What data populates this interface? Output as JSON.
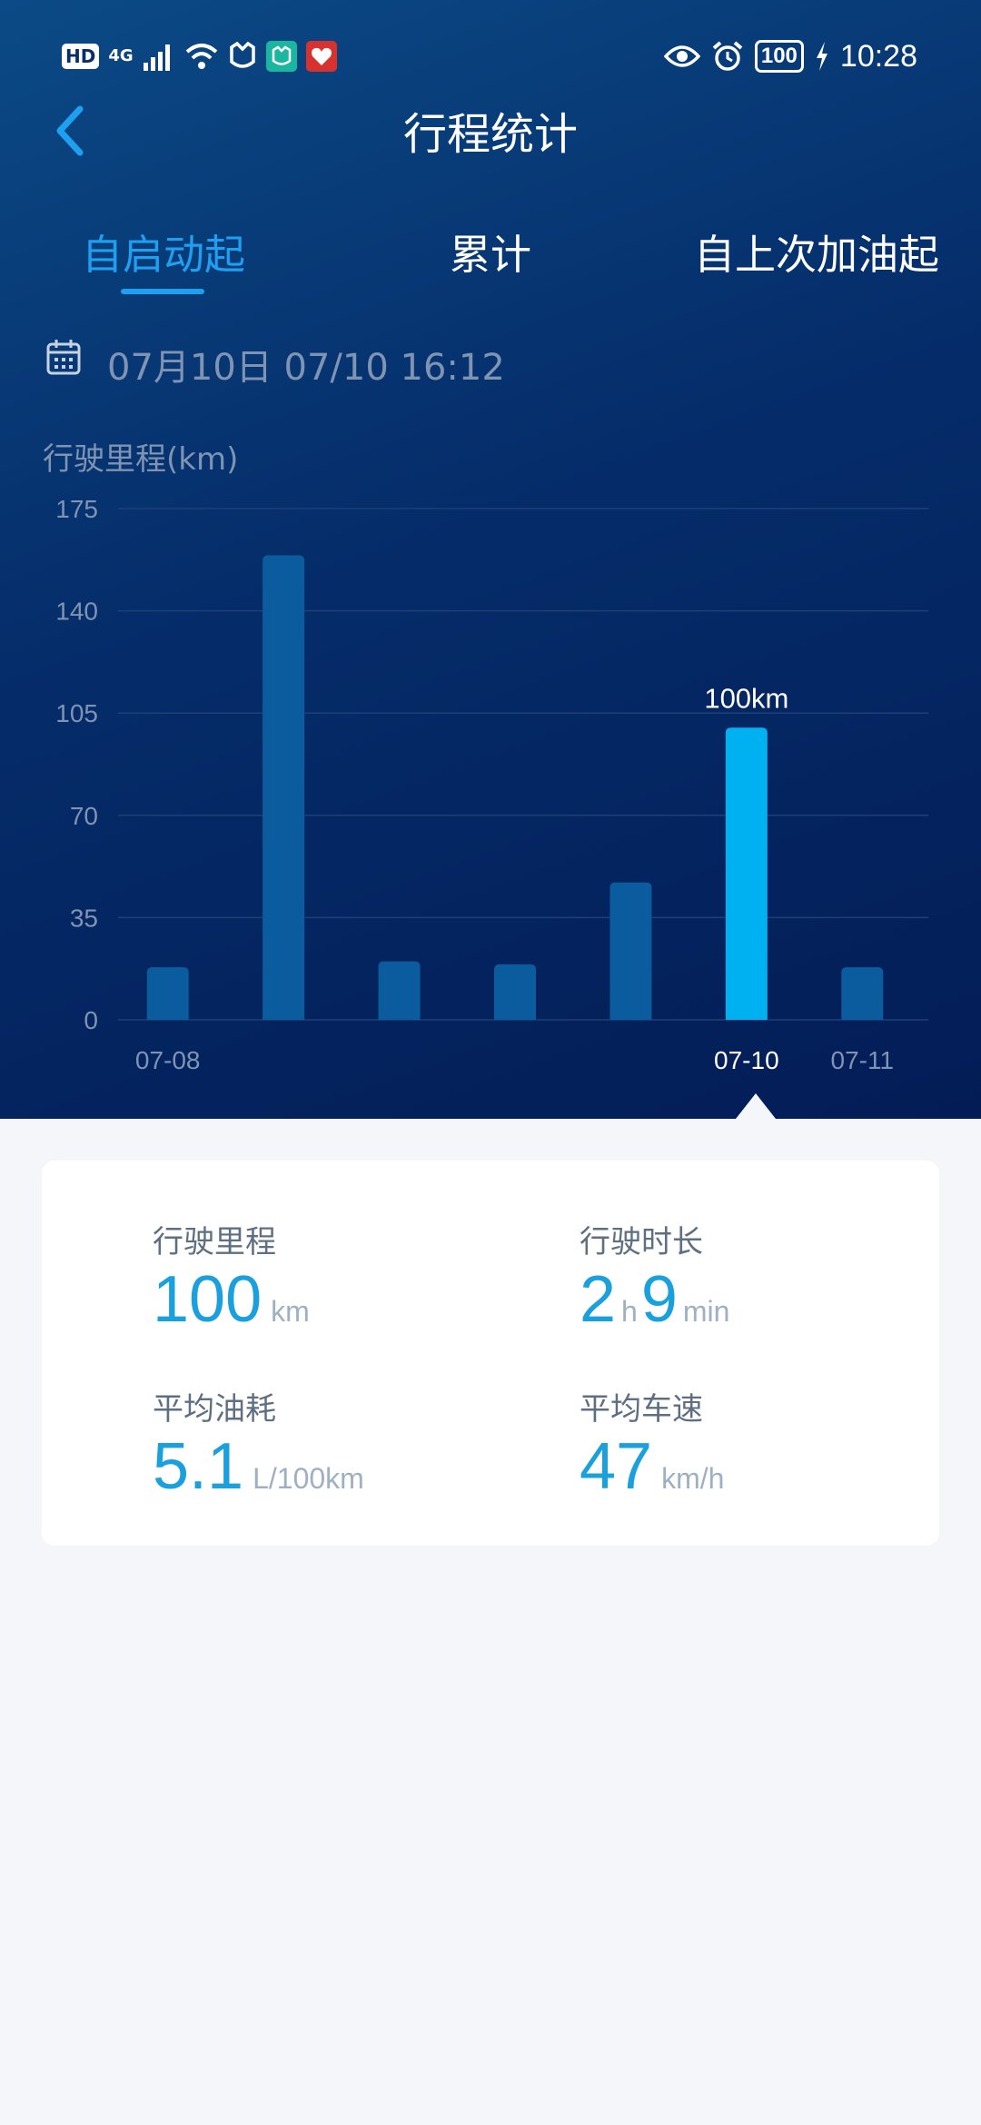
{
  "status_bar": {
    "left_badges": [
      "HD",
      "4G"
    ],
    "time": "10:28",
    "battery": "100"
  },
  "header": {
    "title": "行程统计"
  },
  "tabs": [
    {
      "label": "自启动起",
      "active": true
    },
    {
      "label": "累计",
      "active": false
    },
    {
      "label": "自上次加油起",
      "active": false
    }
  ],
  "date_row": {
    "text": "07月10日 07/10 16:12"
  },
  "chart_data": {
    "type": "bar",
    "ylabel": "行驶里程(km)",
    "ylim": [
      0,
      175
    ],
    "yticks": [
      "175",
      "140",
      "105",
      "70",
      "35",
      "0"
    ],
    "ytick_values": [
      175,
      140,
      105,
      70,
      35,
      0
    ],
    "xtick_labels": [
      "07-08",
      "",
      "",
      "",
      "",
      "07-10",
      "07-11"
    ],
    "values": [
      18,
      159,
      20,
      19,
      47,
      100,
      18
    ],
    "selected_index": 5,
    "selected_label": "100km",
    "colors": {
      "bar": "#0b5c9e",
      "selected": "#00b1f2",
      "grid": "#1f3f77",
      "tick": "#7f93b3"
    }
  },
  "stats": {
    "mileage": {
      "label": "行驶里程",
      "value": "100",
      "unit": "km"
    },
    "duration": {
      "label": "行驶时长",
      "hours": "2",
      "hours_unit": "h",
      "minutes": "9",
      "minutes_unit": "min"
    },
    "fuel": {
      "label": "平均油耗",
      "value": "5.1",
      "unit": "L/100km"
    },
    "speed": {
      "label": "平均车速",
      "value": "47",
      "unit": "km/h"
    }
  }
}
